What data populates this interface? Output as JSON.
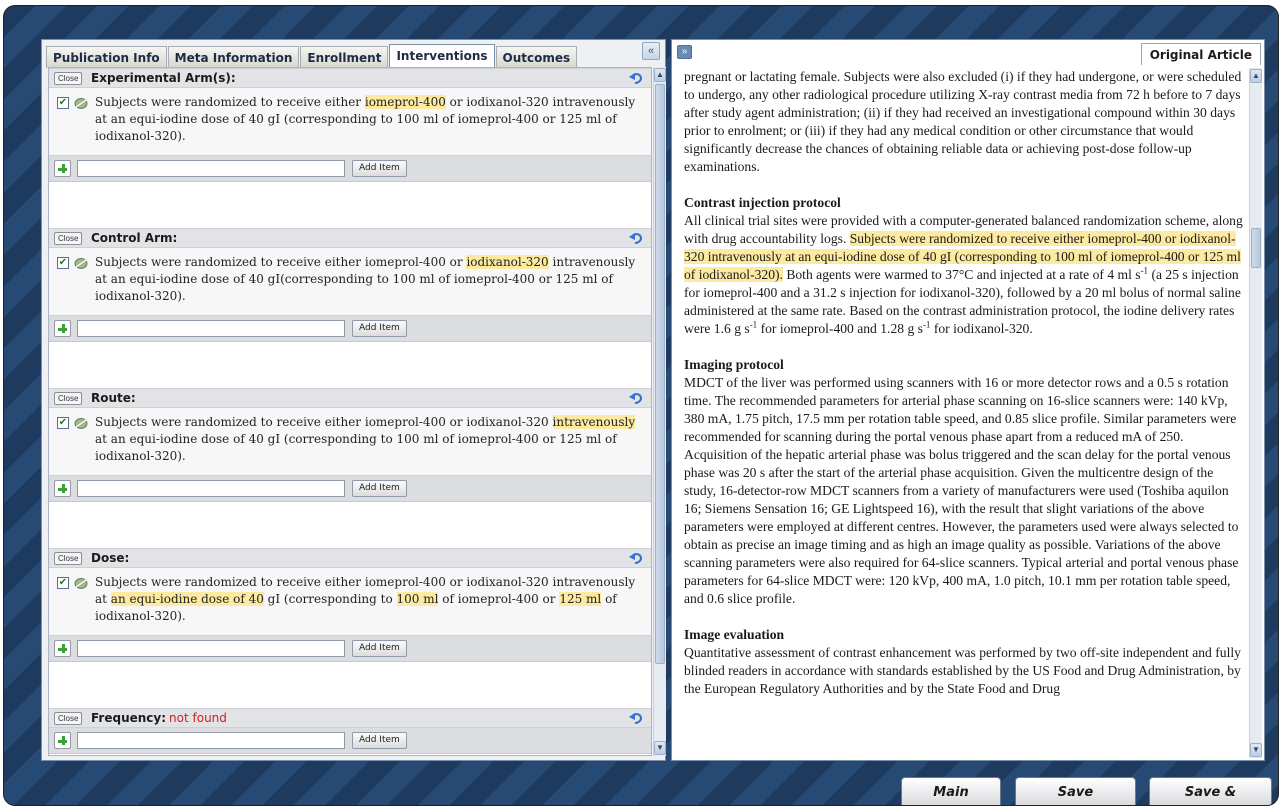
{
  "tabs": [
    "Publication Info",
    "Meta Information",
    "Enrollment",
    "Interventions",
    "Outcomes"
  ],
  "active_tab": "Interventions",
  "panel_controls": {
    "collapse_icon": "«",
    "expand_icon": "»"
  },
  "sections": [
    {
      "title": "Experimental Arm(s):",
      "status": "",
      "sentence_parts": [
        {
          "t": "Subjects were randomized to receive either ",
          "h": false
        },
        {
          "t": "iomeprol-400",
          "h": true
        },
        {
          "t": " or iodixanol-320 intravenously at an equi-iodine dose of 40 gI (corresponding to 100 ml of iomeprol-400 or 125 ml of iodixanol-320).",
          "h": false
        }
      ]
    },
    {
      "title": "Control Arm:",
      "status": "",
      "sentence_parts": [
        {
          "t": "Subjects were randomized to receive either iomeprol-400 or ",
          "h": false
        },
        {
          "t": "iodixanol-320",
          "h": true
        },
        {
          "t": " intravenously at an equi-iodine dose of 40 gI(corresponding to 100 ml of iomeprol-400 or 125 ml of iodixanol-320).",
          "h": false
        }
      ]
    },
    {
      "title": "Route:",
      "status": "",
      "sentence_parts": [
        {
          "t": "Subjects were randomized to receive either iomeprol-400 or iodixanol-320 ",
          "h": false
        },
        {
          "t": "intravenously",
          "h": true
        },
        {
          "t": " at an equi-iodine dose of 40 gI (corresponding to 100 ml of iomeprol-400 or 125 ml of iodixanol-320).",
          "h": false
        }
      ]
    },
    {
      "title": "Dose:",
      "status": "",
      "sentence_parts": [
        {
          "t": "Subjects were randomized to receive either iomeprol-400 or iodixanol-320 intravenously at ",
          "h": false
        },
        {
          "t": "an equi-iodine dose of 40",
          "h": true
        },
        {
          "t": " gI (corresponding to ",
          "h": false
        },
        {
          "t": "100 ml",
          "h": true
        },
        {
          "t": " of iomeprol-400 or ",
          "h": false
        },
        {
          "t": "125 ml",
          "h": true
        },
        {
          "t": " of iodixanol-320).",
          "h": false
        }
      ]
    },
    {
      "title": "Frequency:",
      "status": "not found",
      "sentence_parts": []
    }
  ],
  "close_label": "Close",
  "add_item_label": "Add Item",
  "original_article_tab": "Original Article",
  "article": {
    "intro": "pregnant or lactating female. Subjects were also excluded (i) if they had undergone, or were scheduled to undergo, any other radiological procedure utilizing X-ray contrast media from 72 h before to 7 days after study agent administration; (ii) if they had received an investigational compound within 30 days prior to enrolment; or (iii) if they had any medical condition or other circumstance that would significantly decrease the chances of obtaining reliable data or achieving post-dose follow-up examinations.",
    "contrast_heading": "Contrast injection protocol",
    "contrast_p1": "All clinical trial sites were provided with a computer-generated balanced randomization scheme, along with drug accountability logs. ",
    "contrast_hl": "Subjects were randomized to receive either iomeprol-400 or iodixanol-320 intravenously at an equi-iodine dose of 40 gI (corresponding to 100 ml of iomeprol-400 or 125 ml of iodixanol-320).",
    "contrast_p2": " Both agents were warmed to 37°C and injected at a rate of 4 ml s",
    "sup_neg1": "-1",
    "contrast_p3": " (a 25 s injection for iomeprol-400 and a 31.2 s injection for iodixanol-320), followed by a 20 ml bolus of normal saline administered at the same rate. Based on the contrast administration protocol, the iodine delivery rates were 1.6 g s",
    "contrast_p4": " for iomeprol-400 and 1.28 g s",
    "contrast_p5": " for iodixanol-320.",
    "imaging_heading": "Imaging protocol",
    "imaging_text": "MDCT of the liver was performed using scanners with 16 or more detector rows and a 0.5 s rotation time. The recommended parameters for arterial phase scanning on 16-slice scanners were: 140 kVp, 380 mA, 1.75 pitch, 17.5 mm per rotation table speed, and 0.85 slice profile. Similar parameters were recommended for scanning during the portal venous phase apart from a reduced mA of 250. Acquisition of the hepatic arterial phase was bolus triggered and the scan delay for the portal venous phase was 20 s after the start of the arterial phase acquisition. Given the multicentre design of the study, 16-detector-row MDCT scanners from a variety of manufacturers were used (Toshiba aquilon 16; Siemens Sensation 16; GE Lightspeed 16), with the result that slight variations of the above parameters were employed at different centres. However, the parameters used were always selected to obtain as precise an image timing and as high an image quality as possible. Variations of the above scanning parameters were also required for 64-slice scanners. Typical arterial and portal venous phase parameters for 64-slice MDCT were: 120 kVp, 400 mA, 1.0 pitch, 10.1 mm per rotation table speed, and 0.6 slice profile.",
    "eval_heading": "Image evaluation",
    "eval_text": "Quantitative assessment of contrast enhancement was performed by two off-site independent and fully blinded readers in accordance with standards established by the US Food and Drug Administration, by the European Regulatory Authorities and by the State Food and Drug"
  },
  "buttons": {
    "main_menu": "Main Menu",
    "save_changes": "Save Changes",
    "save_submit": "Save & Submit"
  },
  "icons": {
    "checkbox": "checkbox-checked-icon",
    "leaf": "leaf-icon",
    "undo": "undo-arrow-icon",
    "plus": "plus-icon"
  },
  "colors": {
    "highlight": "#fbeaa0",
    "not_found": "#cc2222",
    "background": "#1e3a5e"
  }
}
